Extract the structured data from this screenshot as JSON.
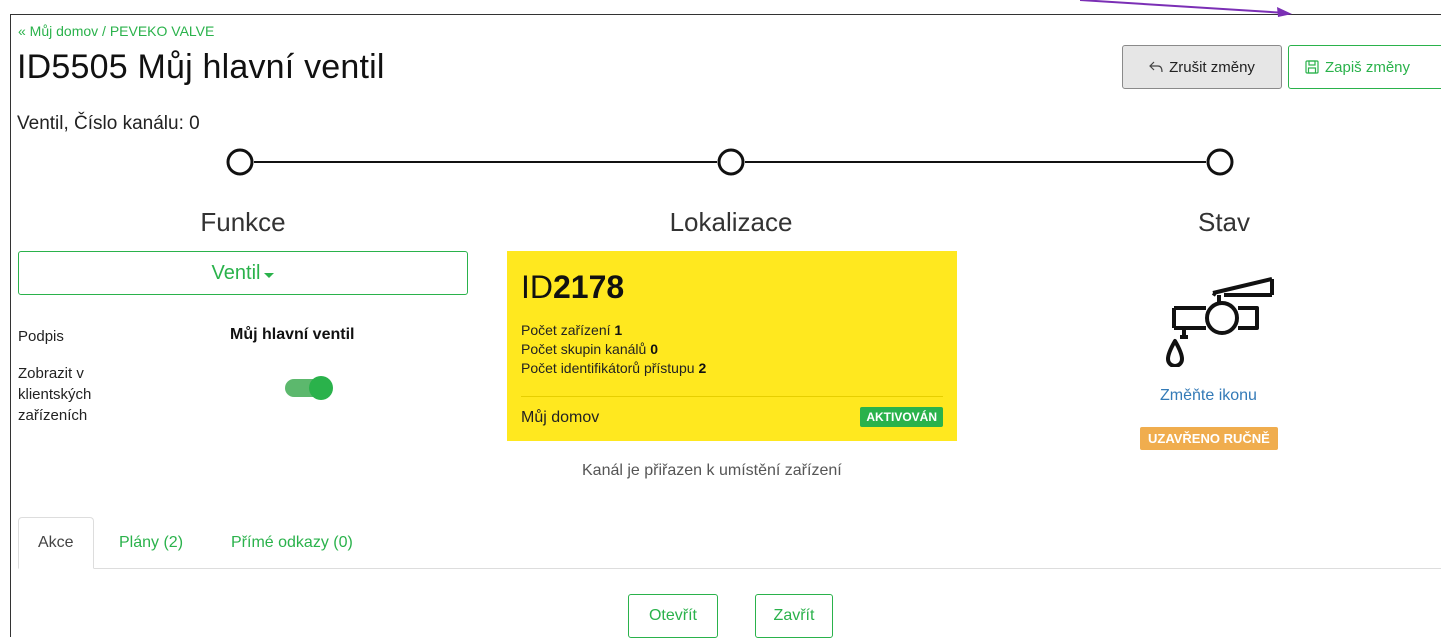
{
  "breadcrumb": {
    "back": "« Můj domov",
    "separator": " / ",
    "current": "PEVEKO VALVE"
  },
  "title": "ID5505 Můj hlavní ventil",
  "toolbar": {
    "cancel_label": "Zrušit změny",
    "cancel_icon": "reply-icon",
    "save_label": "Zapiš změny",
    "save_icon": "floppy-disk-icon"
  },
  "subtitle": "Ventil, Číslo kanálu: 0",
  "steps": {
    "function": "Funkce",
    "location": "Lokalizace",
    "state": "Stav"
  },
  "function": {
    "selected": "Ventil",
    "caption_label": "Podpis",
    "caption_value": "Můj hlavní ventil",
    "show_label": "Zobrazit v klientských zařízeních",
    "show_enabled": true
  },
  "location": {
    "id_prefix": "ID",
    "id_number": "2178",
    "devices_label": "Počet zařízení",
    "devices_value": "1",
    "groups_label": "Počet skupin kanálů",
    "groups_value": "0",
    "access_label": "Počet identifikátorů přístupu",
    "access_value": "2",
    "name": "Můj domov",
    "badge": "AKTIVOVÁN",
    "caption": "Kanál je přiřazen k umístění zařízení"
  },
  "state": {
    "icon": "valve-faucet-icon",
    "change_icon_label": "Změňte ikonu",
    "status": "UZAVŘENO RUČNĚ"
  },
  "tabs": [
    "Akce",
    "Plány (2)",
    "Přímé odkazy (0)"
  ],
  "actions": {
    "open": "Otevřít",
    "close": "Zavřít"
  },
  "colors": {
    "accent": "#2ab24b",
    "card": "#ffe81f",
    "warning": "#f0ad4e",
    "link": "#337ab7",
    "annotation_arrow": "#7b2fb5"
  }
}
